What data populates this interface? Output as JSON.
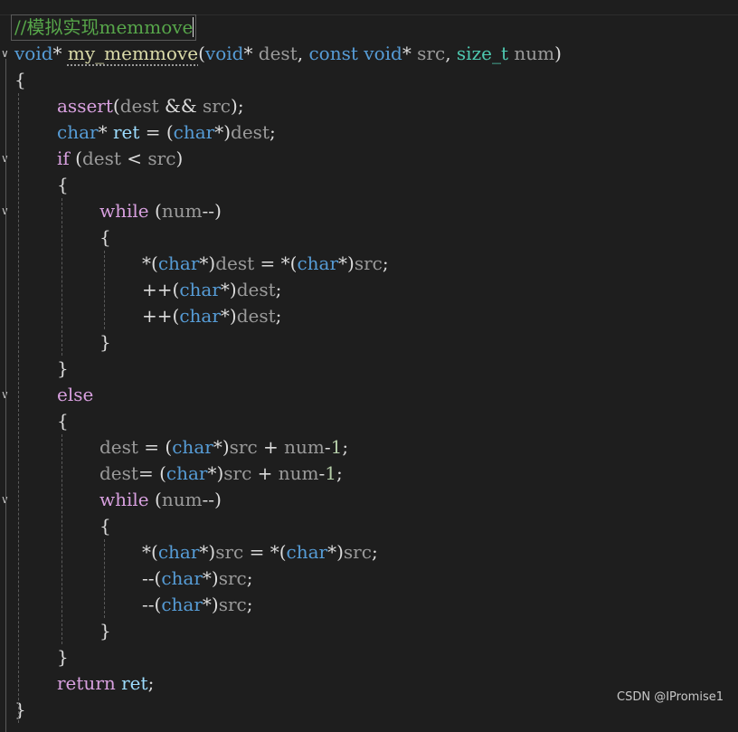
{
  "code_lines": [
    {
      "indent": 0,
      "tokens": [
        {
          "t": "cm",
          "v": "//模拟实现memmove"
        }
      ],
      "cursor": true
    },
    {
      "indent": 0,
      "fold": true,
      "tokens": [
        {
          "t": "kw",
          "v": "void"
        },
        {
          "t": "plain",
          "v": "* "
        },
        {
          "t": "fn",
          "v": "my_memmove",
          "squig": true
        },
        {
          "t": "plain",
          "v": "("
        },
        {
          "t": "kw",
          "v": "void"
        },
        {
          "t": "plain",
          "v": "* "
        },
        {
          "t": "param",
          "v": "dest"
        },
        {
          "t": "plain",
          "v": ", "
        },
        {
          "t": "kw",
          "v": "const"
        },
        {
          "t": "plain",
          "v": " "
        },
        {
          "t": "kw",
          "v": "void"
        },
        {
          "t": "plain",
          "v": "* "
        },
        {
          "t": "param",
          "v": "src"
        },
        {
          "t": "plain",
          "v": ", "
        },
        {
          "t": "type",
          "v": "size_t"
        },
        {
          "t": "plain",
          "v": " "
        },
        {
          "t": "param",
          "v": "num"
        },
        {
          "t": "plain",
          "v": ")"
        }
      ]
    },
    {
      "indent": 0,
      "tokens": [
        {
          "t": "plain",
          "v": "{"
        }
      ]
    },
    {
      "indent": 1,
      "tokens": [
        {
          "t": "ctl",
          "v": "assert"
        },
        {
          "t": "plain",
          "v": "("
        },
        {
          "t": "param",
          "v": "dest"
        },
        {
          "t": "plain",
          "v": " && "
        },
        {
          "t": "param",
          "v": "src"
        },
        {
          "t": "plain",
          "v": ");"
        }
      ]
    },
    {
      "indent": 1,
      "tokens": [
        {
          "t": "kw",
          "v": "char"
        },
        {
          "t": "plain",
          "v": "* "
        },
        {
          "t": "var",
          "v": "ret"
        },
        {
          "t": "plain",
          "v": " = ("
        },
        {
          "t": "kw",
          "v": "char"
        },
        {
          "t": "plain",
          "v": "*)"
        },
        {
          "t": "param",
          "v": "dest"
        },
        {
          "t": "plain",
          "v": ";"
        }
      ]
    },
    {
      "indent": 1,
      "fold": true,
      "tokens": [
        {
          "t": "ctl",
          "v": "if"
        },
        {
          "t": "plain",
          "v": " ("
        },
        {
          "t": "param",
          "v": "dest"
        },
        {
          "t": "plain",
          "v": " < "
        },
        {
          "t": "param",
          "v": "src"
        },
        {
          "t": "plain",
          "v": ")"
        }
      ]
    },
    {
      "indent": 1,
      "tokens": [
        {
          "t": "plain",
          "v": "{"
        }
      ]
    },
    {
      "indent": 2,
      "fold": true,
      "tokens": [
        {
          "t": "ctl",
          "v": "while"
        },
        {
          "t": "plain",
          "v": " ("
        },
        {
          "t": "param",
          "v": "num"
        },
        {
          "t": "plain",
          "v": "--)"
        }
      ]
    },
    {
      "indent": 2,
      "tokens": [
        {
          "t": "plain",
          "v": "{"
        }
      ]
    },
    {
      "indent": 3,
      "tokens": [
        {
          "t": "plain",
          "v": "*("
        },
        {
          "t": "kw",
          "v": "char"
        },
        {
          "t": "plain",
          "v": "*)"
        },
        {
          "t": "param",
          "v": "dest"
        },
        {
          "t": "plain",
          "v": " = *("
        },
        {
          "t": "kw",
          "v": "char"
        },
        {
          "t": "plain",
          "v": "*)"
        },
        {
          "t": "param",
          "v": "src"
        },
        {
          "t": "plain",
          "v": ";"
        }
      ]
    },
    {
      "indent": 3,
      "tokens": [
        {
          "t": "plain",
          "v": "++("
        },
        {
          "t": "kw",
          "v": "char"
        },
        {
          "t": "plain",
          "v": "*)"
        },
        {
          "t": "param",
          "v": "dest"
        },
        {
          "t": "plain",
          "v": ";"
        }
      ]
    },
    {
      "indent": 3,
      "tokens": [
        {
          "t": "plain",
          "v": "++("
        },
        {
          "t": "kw",
          "v": "char"
        },
        {
          "t": "plain",
          "v": "*)"
        },
        {
          "t": "param",
          "v": "dest"
        },
        {
          "t": "plain",
          "v": ";"
        }
      ]
    },
    {
      "indent": 2,
      "tokens": [
        {
          "t": "plain",
          "v": "}"
        }
      ]
    },
    {
      "indent": 1,
      "tokens": [
        {
          "t": "plain",
          "v": "}"
        }
      ]
    },
    {
      "indent": 1,
      "fold": true,
      "tokens": [
        {
          "t": "ctl",
          "v": "else"
        }
      ]
    },
    {
      "indent": 1,
      "tokens": [
        {
          "t": "plain",
          "v": "{"
        }
      ]
    },
    {
      "indent": 2,
      "tokens": [
        {
          "t": "param",
          "v": "dest"
        },
        {
          "t": "plain",
          "v": " = ("
        },
        {
          "t": "kw",
          "v": "char"
        },
        {
          "t": "plain",
          "v": "*)"
        },
        {
          "t": "param",
          "v": "src"
        },
        {
          "t": "plain",
          "v": " + "
        },
        {
          "t": "param",
          "v": "num"
        },
        {
          "t": "plain",
          "v": "-"
        },
        {
          "t": "num",
          "v": "1"
        },
        {
          "t": "plain",
          "v": ";"
        }
      ]
    },
    {
      "indent": 2,
      "tokens": [
        {
          "t": "param",
          "v": "dest"
        },
        {
          "t": "plain",
          "v": "= ("
        },
        {
          "t": "kw",
          "v": "char"
        },
        {
          "t": "plain",
          "v": "*)"
        },
        {
          "t": "param",
          "v": "src"
        },
        {
          "t": "plain",
          "v": " + "
        },
        {
          "t": "param",
          "v": "num"
        },
        {
          "t": "plain",
          "v": "-"
        },
        {
          "t": "num",
          "v": "1"
        },
        {
          "t": "plain",
          "v": ";"
        }
      ]
    },
    {
      "indent": 2,
      "fold": true,
      "tokens": [
        {
          "t": "ctl",
          "v": "while"
        },
        {
          "t": "plain",
          "v": " ("
        },
        {
          "t": "param",
          "v": "num"
        },
        {
          "t": "plain",
          "v": "--)"
        }
      ]
    },
    {
      "indent": 2,
      "tokens": [
        {
          "t": "plain",
          "v": "{"
        }
      ]
    },
    {
      "indent": 3,
      "tokens": [
        {
          "t": "plain",
          "v": "*("
        },
        {
          "t": "kw",
          "v": "char"
        },
        {
          "t": "plain",
          "v": "*)"
        },
        {
          "t": "param",
          "v": "src"
        },
        {
          "t": "plain",
          "v": " = *("
        },
        {
          "t": "kw",
          "v": "char"
        },
        {
          "t": "plain",
          "v": "*)"
        },
        {
          "t": "param",
          "v": "src"
        },
        {
          "t": "plain",
          "v": ";"
        }
      ]
    },
    {
      "indent": 3,
      "tokens": [
        {
          "t": "plain",
          "v": "--("
        },
        {
          "t": "kw",
          "v": "char"
        },
        {
          "t": "plain",
          "v": "*)"
        },
        {
          "t": "param",
          "v": "src"
        },
        {
          "t": "plain",
          "v": ";"
        }
      ]
    },
    {
      "indent": 3,
      "tokens": [
        {
          "t": "plain",
          "v": "--("
        },
        {
          "t": "kw",
          "v": "char"
        },
        {
          "t": "plain",
          "v": "*)"
        },
        {
          "t": "param",
          "v": "src"
        },
        {
          "t": "plain",
          "v": ";"
        }
      ]
    },
    {
      "indent": 2,
      "tokens": [
        {
          "t": "plain",
          "v": "}"
        }
      ]
    },
    {
      "indent": 1,
      "tokens": [
        {
          "t": "plain",
          "v": "}"
        }
      ]
    },
    {
      "indent": 1,
      "tokens": [
        {
          "t": "ctl",
          "v": "return"
        },
        {
          "t": "plain",
          "v": " "
        },
        {
          "t": "var",
          "v": "ret"
        },
        {
          "t": "plain",
          "v": ";"
        }
      ]
    },
    {
      "indent": 0,
      "tokens": [
        {
          "t": "plain",
          "v": "}"
        }
      ]
    }
  ],
  "watermark": "CSDN @IPromise1",
  "colors": {
    "background": "#1e1e1e",
    "keyword": "#569cd6",
    "control": "#d8a0df",
    "function": "#dcdcaa",
    "type": "#4ec9b0",
    "comment": "#57a64a",
    "variable": "#9cdcfe",
    "number": "#b5cea8"
  }
}
